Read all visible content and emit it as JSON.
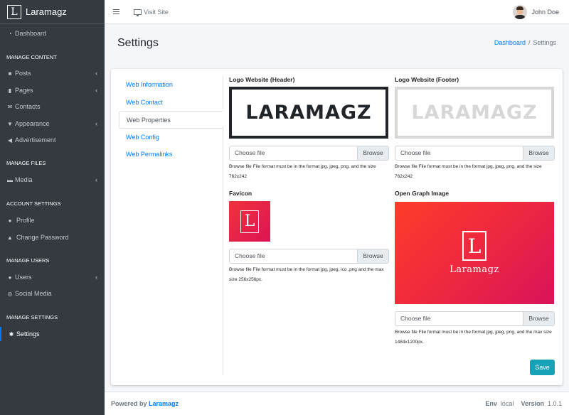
{
  "brand": {
    "logo_letter": "L",
    "name": "Laramagz"
  },
  "topbar": {
    "visit_site": "Visit Site",
    "user_name": "John Doe"
  },
  "sidebar": {
    "dashboard": "Dashboard",
    "manage_content": "MANAGE CONTENT",
    "posts": "Posts",
    "pages": "Pages",
    "contacts": "Contacts",
    "appearance": "Appearance",
    "advertisement": "Advertisement",
    "manage_files": "MANAGE FILES",
    "media": "Media",
    "account_settings": "ACCOUNT SETTINGS",
    "profile": "Profile",
    "change_password": "Change Password",
    "manage_users": "MANAGE USERS",
    "users": "Users",
    "social_media": "Social Media",
    "manage_settings": "MANAGE SETTINGS",
    "settings": "Settings"
  },
  "page": {
    "title": "Settings"
  },
  "breadcrumb": {
    "home": "Dashboard",
    "separator": "/",
    "current": "Settings"
  },
  "tabs": [
    "Web Information",
    "Web Contact",
    "Web Properties",
    "Web Config",
    "Web Permalinks"
  ],
  "form": {
    "logo_header": {
      "label": "Logo Website (Header)",
      "logo_text": "LARAMAGZ",
      "file_placeholder": "Choose file",
      "browse": "Browse",
      "help": "Browse file File format must be in the format jpg, jpeg, png, and the size 762x242"
    },
    "logo_footer": {
      "label": "Logo Website (Footer)",
      "logo_text": "LARAMAGZ",
      "file_placeholder": "Choose file",
      "browse": "Browse",
      "help": "Browse file File format must be in the format jpg, jpeg, png, and the size 762x242"
    },
    "favicon": {
      "label": "Favicon",
      "logo_letter": "L",
      "file_placeholder": "Choose file",
      "browse": "Browse",
      "help": "Browse file File format must be in the format jpg, jpeg, ico ,png and the max size 256x256px."
    },
    "og_image": {
      "label": "Open Graph Image",
      "logo_letter": "L",
      "logo_text": "Laramagz",
      "file_placeholder": "Choose file",
      "browse": "Browse",
      "help": "Browse file File format must be in the format jpg, jpeg, png, and the max size 1484x1200px."
    },
    "save": "Save"
  },
  "footer": {
    "powered_by": "Powered by",
    "brand": "Laramagz",
    "env_label": "Env",
    "env_value": "local",
    "version_label": "Version",
    "version_value": "1.0.1"
  },
  "colors": {
    "sidebar_bg": "#343a40",
    "accent": "#007bff",
    "save_button": "#17a2b8",
    "brand_red": "#f0333b"
  }
}
